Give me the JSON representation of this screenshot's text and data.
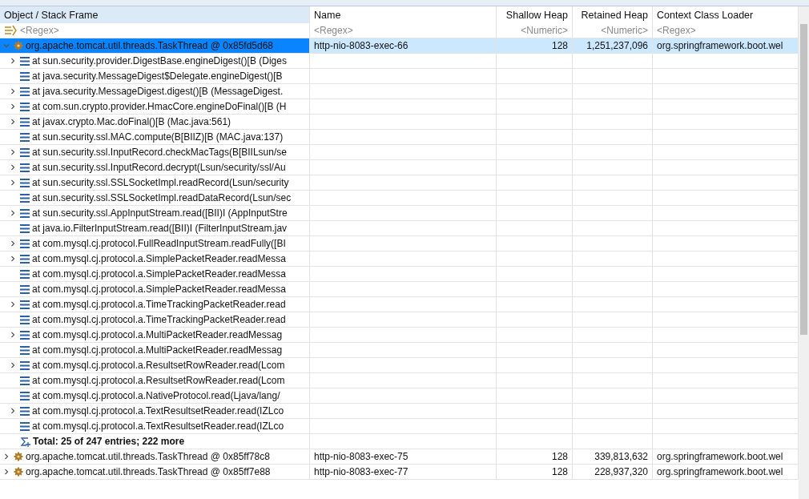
{
  "table": {
    "columns": [
      {
        "label": "Object / Stack Frame",
        "filter": "<Regex>"
      },
      {
        "label": "Name",
        "filter": "<Regex>"
      },
      {
        "label": "Shallow Heap",
        "filter": "<Numeric>"
      },
      {
        "label": "Retained Heap",
        "filter": "<Numeric>"
      },
      {
        "label": "Context Class Loader",
        "filter": "<Regex>"
      }
    ],
    "rows": [
      {
        "kind": "thread",
        "object": "org.apache.tomcat.util.threads.TaskThread @ 0x85fd5d68",
        "name": "http-nio-8083-exec-66",
        "shallow": "128",
        "retained": "1,251,237,096",
        "loader": "org.springframework.boot.wel",
        "expanded": true,
        "selected": true,
        "children": [
          {
            "kind": "frame",
            "text": "at sun.security.provider.DigestBase.engineDigest()[B (Diges",
            "expandable": true
          },
          {
            "kind": "frame",
            "text": "at java.security.MessageDigest$Delegate.engineDigest()[B",
            "expandable": false
          },
          {
            "kind": "frame",
            "text": "at java.security.MessageDigest.digest()[B (MessageDigest.",
            "expandable": true
          },
          {
            "kind": "frame",
            "text": "at com.sun.crypto.provider.HmacCore.engineDoFinal()[B (H",
            "expandable": true
          },
          {
            "kind": "frame",
            "text": "at javax.crypto.Mac.doFinal()[B (Mac.java:561)",
            "expandable": true
          },
          {
            "kind": "frame",
            "text": "at sun.security.ssl.MAC.compute(B[BIIZ)[B (MAC.java:137)",
            "expandable": false
          },
          {
            "kind": "frame",
            "text": "at sun.security.ssl.InputRecord.checkMacTags(B[BIILsun/se",
            "expandable": true
          },
          {
            "kind": "frame",
            "text": "at sun.security.ssl.InputRecord.decrypt(Lsun/security/ssl/Au",
            "expandable": true
          },
          {
            "kind": "frame",
            "text": "at sun.security.ssl.SSLSocketImpl.readRecord(Lsun/security",
            "expandable": true
          },
          {
            "kind": "frame",
            "text": "at sun.security.ssl.SSLSocketImpl.readDataRecord(Lsun/sec",
            "expandable": false
          },
          {
            "kind": "frame",
            "text": "at sun.security.ssl.AppInputStream.read([BII)I (AppInputStre",
            "expandable": true
          },
          {
            "kind": "frame",
            "text": "at java.io.FilterInputStream.read([BII)I (FilterInputStream.jav",
            "expandable": false
          },
          {
            "kind": "frame",
            "text": "at com.mysql.cj.protocol.FullReadInputStream.readFully([BI",
            "expandable": true
          },
          {
            "kind": "frame",
            "text": "at com.mysql.cj.protocol.a.SimplePacketReader.readMessa",
            "expandable": true
          },
          {
            "kind": "frame",
            "text": "at com.mysql.cj.protocol.a.SimplePacketReader.readMessa",
            "expandable": false
          },
          {
            "kind": "frame",
            "text": "at com.mysql.cj.protocol.a.SimplePacketReader.readMessa",
            "expandable": false
          },
          {
            "kind": "frame",
            "text": "at com.mysql.cj.protocol.a.TimeTrackingPacketReader.read",
            "expandable": true
          },
          {
            "kind": "frame",
            "text": "at com.mysql.cj.protocol.a.TimeTrackingPacketReader.read",
            "expandable": false
          },
          {
            "kind": "frame",
            "text": "at com.mysql.cj.protocol.a.MultiPacketReader.readMessag",
            "expandable": true
          },
          {
            "kind": "frame",
            "text": "at com.mysql.cj.protocol.a.MultiPacketReader.readMessag",
            "expandable": false
          },
          {
            "kind": "frame",
            "text": "at com.mysql.cj.protocol.a.ResultsetRowReader.read(Lcom",
            "expandable": true
          },
          {
            "kind": "frame",
            "text": "at com.mysql.cj.protocol.a.ResultsetRowReader.read(Lcom",
            "expandable": false
          },
          {
            "kind": "frame",
            "text": "at com.mysql.cj.protocol.a.NativeProtocol.read(Ljava/lang/",
            "expandable": false
          },
          {
            "kind": "frame",
            "text": "at com.mysql.cj.protocol.a.TextResultsetReader.read(IZLco",
            "expandable": true
          },
          {
            "kind": "frame",
            "text": "at com.mysql.cj.protocol.a.TextResultsetReader.read(IZLco",
            "expandable": false
          },
          {
            "kind": "total",
            "text": "Total: 25 of 247 entries; 222 more"
          }
        ]
      },
      {
        "kind": "thread",
        "object": "org.apache.tomcat.util.threads.TaskThread @ 0x85ff78c8",
        "name": "http-nio-8083-exec-75",
        "shallow": "128",
        "retained": "339,813,632",
        "loader": "org.springframework.boot.wel",
        "expanded": false,
        "selected": false
      },
      {
        "kind": "thread",
        "object": "org.apache.tomcat.util.threads.TaskThread @ 0x85ff7e88",
        "name": "http-nio-8083-exec-77",
        "shallow": "128",
        "retained": "228,937,320",
        "loader": "org.springframework.boot.wel",
        "expanded": false,
        "selected": false
      }
    ]
  }
}
